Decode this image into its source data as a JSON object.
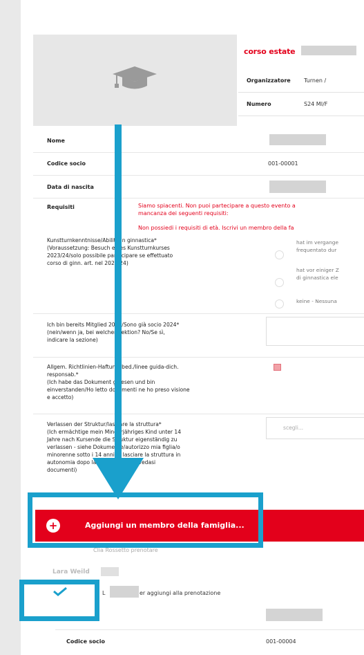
{
  "course": {
    "title": "corso estate",
    "info": [
      {
        "label": "Organizzatore",
        "value": "Turnen /"
      },
      {
        "label": "Numero",
        "value": "S24 MI/F"
      }
    ]
  },
  "form": {
    "nome_label": "Nome",
    "codice_socio_label": "Codice socio",
    "codice_socio_value": "001-00001",
    "data_nascita_label": "Data di nascita",
    "requisiti_label": "Requisiti",
    "requisiti_error_1": "Siamo spiacenti. Non puoi partecipare a questo evento a",
    "requisiti_error_2": "mancanza dei seguenti requisiti:",
    "requisiti_error_3": "Non possiedi i requisiti di età. Iscrivi un membro della fa",
    "skills": {
      "lines": [
        "Kunstturnkenntnisse/Abilità in ginnastica*",
        "(Voraussetzung: Besuch eines Kunstturnkurses",
        "2023/24/solo possibile partecipare se effettuato",
        "corso di ginn. art. nel 2023/24)"
      ],
      "options": [
        {
          "line1": "hat im vergange",
          "line2": "frequentato dur"
        },
        {
          "line1": "hat vor einiger Z",
          "line2": "di ginnastica ele"
        },
        {
          "line1": "keine - Nessuna",
          "line2": ""
        }
      ]
    },
    "member": {
      "lines": [
        "Ich bin bereits Mitglied 2024/Sono già socio 2024*",
        "(nein/wenn ja, bei welcher Sektion? No/Se sì,",
        "indicare la sezione)"
      ]
    },
    "guidelines": {
      "lines": [
        "Allgem. Richtlinien-Haftungsbed./linee guida-dich.",
        "responsab.*",
        "(Ich habe das Dokument gelesen und bin",
        "einverstanden/Ho letto documenti ne ho preso visione",
        "e accetto)"
      ]
    },
    "leave": {
      "lines": [
        "Verlassen der Struktur/lasciare la struttura*",
        "(Ich ermächtige mein Minderjähriges Kind unter 14",
        "Jahre nach Kursende die Struktur eigenständig zu",
        "verlassen - siehe Dokumente/autorizzo mia figlia/o",
        "minorenne sotto i 14 anni di lasciare la struttura in",
        "autonomia dopo la fine del corso - vedasi",
        "documenti)"
      ],
      "select_placeholder": "scegli..."
    }
  },
  "add_family": {
    "label": "Aggiungi un membro della famiglia...",
    "note": "Clia Rossetto prenotare"
  },
  "second_member": {
    "name": "Lara Weild",
    "checkbox_label": "er aggiungi alla prenotazione",
    "codice_socio_label": "Codice socio",
    "codice_socio_value": "001-00004"
  },
  "colors": {
    "accent": "#e3001b",
    "annotation": "#1aa0cc"
  }
}
